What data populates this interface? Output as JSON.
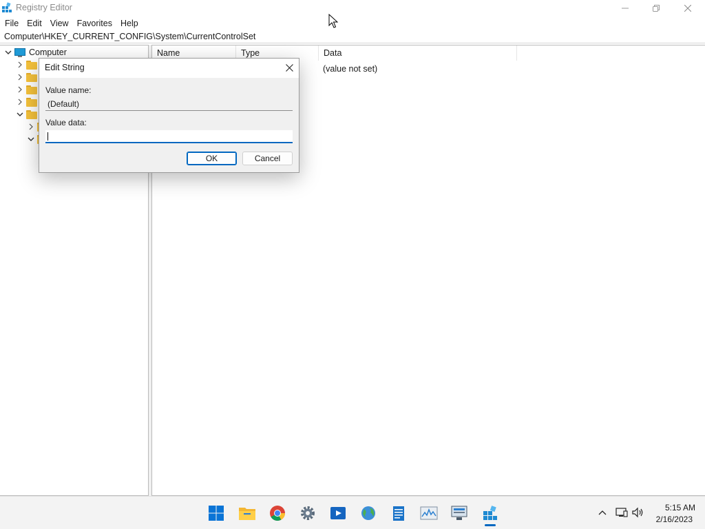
{
  "window": {
    "title": "Registry Editor",
    "icons": {
      "app": "registry-editor-icon",
      "minimize": "minimize-icon",
      "maximize": "maximize-icon",
      "close": "close-icon"
    }
  },
  "menu": [
    "File",
    "Edit",
    "View",
    "Favorites",
    "Help"
  ],
  "address": "Computer\\HKEY_CURRENT_CONFIG\\System\\CurrentControlSet",
  "tree": {
    "root_label": "Computer",
    "root_icon": "computer-icon",
    "folder_icon": "folder-icon"
  },
  "list": {
    "columns": [
      "Name",
      "Type",
      "Data"
    ],
    "rows": [
      {
        "data": "(value not set)"
      }
    ]
  },
  "dialog": {
    "title": "Edit String",
    "value_name_label": "Value name:",
    "value_name": "(Default)",
    "value_data_label": "Value data:",
    "value_data": "",
    "ok_label": "OK",
    "cancel_label": "Cancel"
  },
  "taskbar": {
    "apps": [
      "start-icon",
      "file-explorer-icon",
      "chrome-icon",
      "settings-icon",
      "media-player-icon",
      "globe-icon",
      "notepad-icon",
      "performance-monitor-icon",
      "remote-desktop-icon",
      "registry-editor-icon"
    ],
    "active_app": "registry-editor-icon",
    "tray": [
      "chevron-up-icon",
      "network-icon",
      "volume-icon"
    ],
    "time": "5:15 AM",
    "date": "2/16/2023"
  },
  "colors": {
    "accent": "#0067c0",
    "folder": "#f5c23c",
    "taskbar": "#f3f3f3"
  }
}
